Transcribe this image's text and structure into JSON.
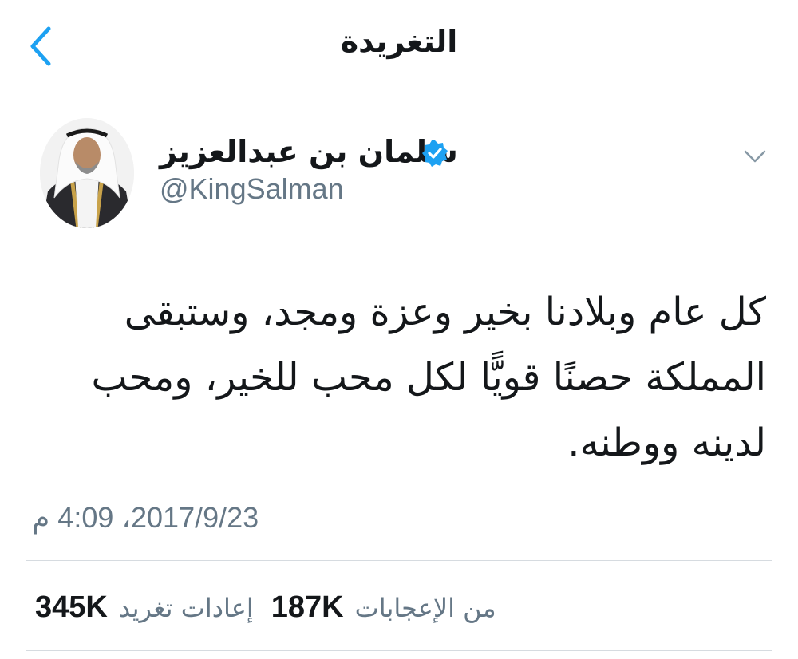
{
  "header": {
    "title": "التغريدة",
    "back_icon": "chevron-left-icon"
  },
  "tweet": {
    "author_name": "سلمان بن عبدالعزيز",
    "handle": "@KingSalman",
    "verified": true,
    "text": "كل عام وبلادنا بخير وعزة ومجد، وستبقى المملكة حصنًا قويًّا لكل محب للخير، ومحب لدينه ووطنه.",
    "timestamp": "2017/9/23، 4:09 م"
  },
  "stats": {
    "retweets_count": "345K",
    "retweets_label": "إعادات تغريد",
    "likes_count": "187K",
    "likes_label": "من الإعجابات"
  },
  "colors": {
    "accent": "#1da1f2",
    "secondary_text": "#657786",
    "divider": "#d6dbe0"
  }
}
